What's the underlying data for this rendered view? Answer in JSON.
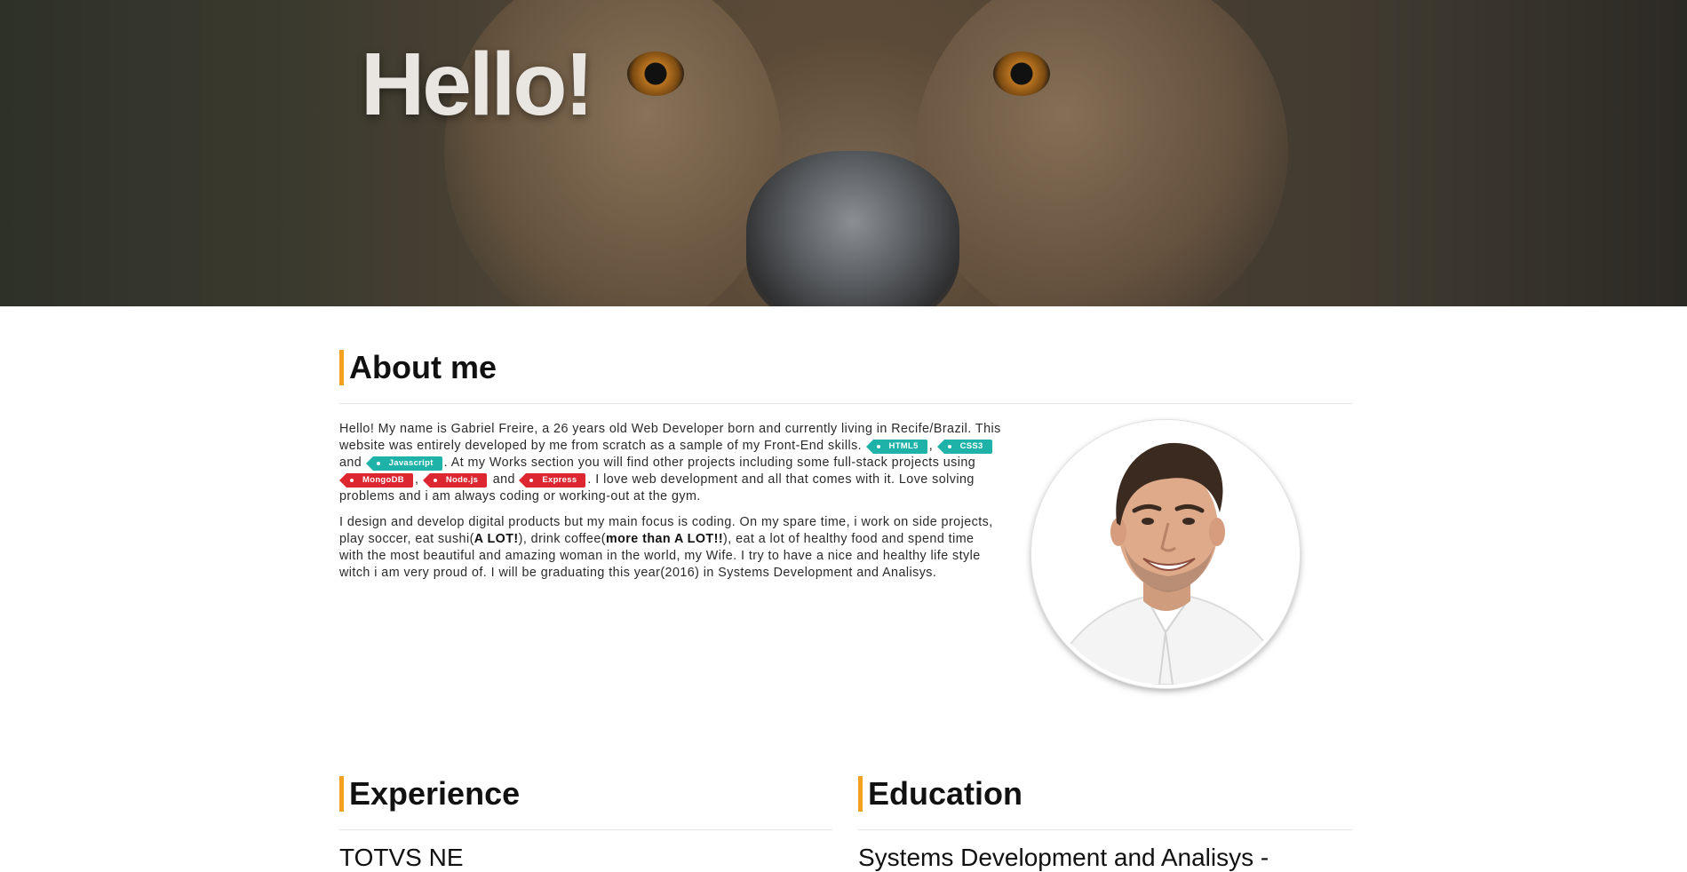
{
  "hero": {
    "title": "Hello!"
  },
  "about": {
    "title": "About me",
    "p1": {
      "t1": "Hello! My name is Gabriel Freire, a 26 years old Web Developer born and currently living in Recife/Brazil. This website was entirely developed by me from scratch as a sample of my Front-End skills.",
      "sep1": ",",
      "sep2": ",",
      "and1": "and",
      "t2": ". At my Works section you will find other projects including some full-stack projects using",
      "sep3": ",",
      "and2": "and",
      "t3": ". I love web development and all that comes with it. Love solving problems and i am always coding or working-out at the gym."
    },
    "tags": {
      "html5": "HTML5",
      "css3": "CSS3",
      "javascript": "Javascript",
      "mongodb": "MongoDB",
      "nodejs": "Node.js",
      "express": "Express"
    },
    "p2": {
      "t1": "I design and develop digital products but my main focus is coding. On my spare time, i work on side projects, play soccer, eat sushi(",
      "b1": "A LOT!",
      "t2": "), drink coffee(",
      "b2": "more than A LOT!!",
      "t3": "), eat a lot of healthy food and spend time with the most beautiful and amazing woman in the world, my Wife. I try to have a nice and healthy life style witch i am very proud of. I will be graduating this year(2016) in Systems Development and Analisys."
    }
  },
  "experience": {
    "title": "Experience",
    "first_item": "TOTVS NE"
  },
  "education": {
    "title": "Education",
    "first_item": "Systems Development and Analisys -"
  },
  "colors": {
    "accent": "#f5a01e",
    "tag_frontend": "#1fb2a9",
    "tag_backend": "#dc2630"
  }
}
